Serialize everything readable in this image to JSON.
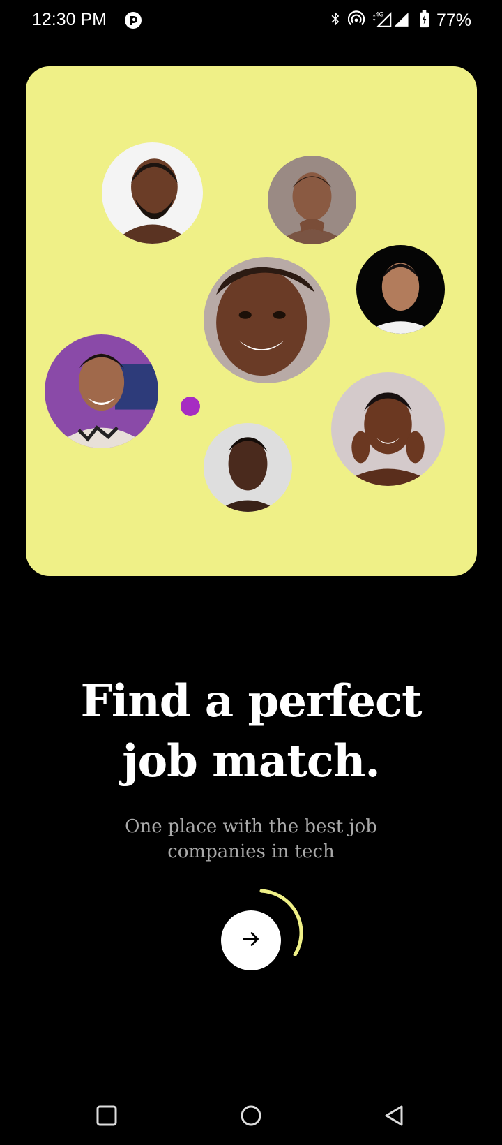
{
  "status_bar": {
    "time": "12:30 PM",
    "battery": "77%",
    "network": "4G",
    "icons": [
      "app-badge-icon",
      "bluetooth-icon",
      "hotspot-icon",
      "signal-icon",
      "battery-charging-icon"
    ]
  },
  "onboarding": {
    "headline": "Find a perfect job match.",
    "subtitle": "One place with the best job companies in tech",
    "progress": 0.33,
    "accent_color": "#eff087",
    "dot_color": "#a62cc2",
    "next_icon": "arrow-right-icon"
  },
  "nav_bar": {
    "icons": [
      "recents-square-icon",
      "home-circle-icon",
      "back-triangle-icon"
    ]
  }
}
